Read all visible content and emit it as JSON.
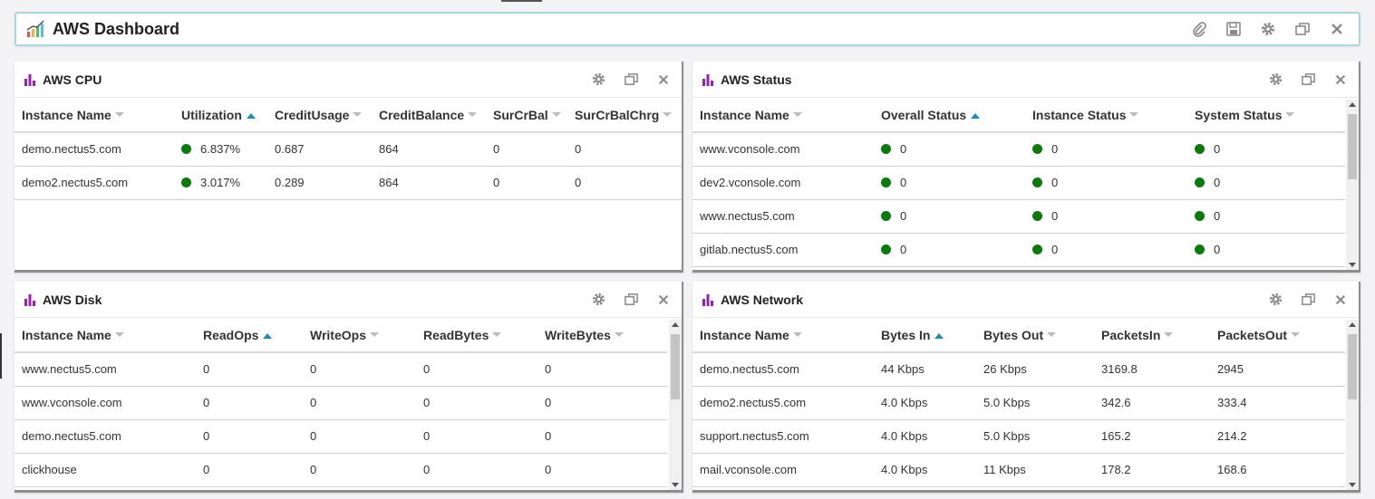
{
  "dashboard": {
    "title": "AWS Dashboard"
  },
  "panels": {
    "cpu": {
      "title": "AWS CPU",
      "columns": [
        "Instance Name",
        "Utilization",
        "CreditUsage",
        "CreditBalance",
        "SurCrBal",
        "SurCrBalChrg"
      ],
      "sorted_column": "Utilization",
      "rows": [
        [
          "demo.nectus5.com",
          "6.837%",
          "0.687",
          "864",
          "0",
          "0"
        ],
        [
          "demo2.nectus5.com",
          "3.017%",
          "0.289",
          "864",
          "0",
          "0"
        ]
      ]
    },
    "status": {
      "title": "AWS Status",
      "columns": [
        "Instance Name",
        "Overall Status",
        "Instance Status",
        "System Status"
      ],
      "sorted_column": "Overall Status",
      "rows": [
        [
          "www.vconsole.com",
          "0",
          "0",
          "0"
        ],
        [
          "dev2.vconsole.com",
          "0",
          "0",
          "0"
        ],
        [
          "www.nectus5.com",
          "0",
          "0",
          "0"
        ],
        [
          "gitlab.nectus5.com",
          "0",
          "0",
          "0"
        ]
      ]
    },
    "disk": {
      "title": "AWS Disk",
      "columns": [
        "Instance Name",
        "ReadOps",
        "WriteOps",
        "ReadBytes",
        "WriteBytes"
      ],
      "sorted_column": "ReadOps",
      "rows": [
        [
          "www.nectus5.com",
          "0",
          "0",
          "0",
          "0"
        ],
        [
          "www.vconsole.com",
          "0",
          "0",
          "0",
          "0"
        ],
        [
          "demo.nectus5.com",
          "0",
          "0",
          "0",
          "0"
        ],
        [
          "clickhouse",
          "0",
          "0",
          "0",
          "0"
        ]
      ]
    },
    "network": {
      "title": "AWS Network",
      "columns": [
        "Instance Name",
        "Bytes In",
        "Bytes Out",
        "PacketsIn",
        "PacketsOut"
      ],
      "sorted_column": "Bytes In",
      "rows": [
        [
          "demo.nectus5.com",
          "44 Kbps",
          "26 Kbps",
          "3169.8",
          "2945"
        ],
        [
          "demo2.nectus5.com",
          "4.0 Kbps",
          "5.0 Kbps",
          "342.6",
          "333.4"
        ],
        [
          "support.nectus5.com",
          "4.0 Kbps",
          "5.0 Kbps",
          "165.2",
          "214.2"
        ],
        [
          "mail.vconsole.com",
          "4.0 Kbps",
          "11 Kbps",
          "178.2",
          "168.6"
        ]
      ]
    }
  },
  "colors": {
    "accent_purple": "#9b1fb5",
    "status_green": "#0a7a0a",
    "sort_arrow": "#1f8bb0",
    "header_border": "#a9d6e0"
  },
  "icons": {
    "header_tools": [
      "paperclip-icon",
      "save-icon",
      "gear-icon",
      "restore-window-icon",
      "close-icon"
    ],
    "panel_tools": [
      "gear-icon",
      "restore-window-icon",
      "close-icon"
    ]
  }
}
